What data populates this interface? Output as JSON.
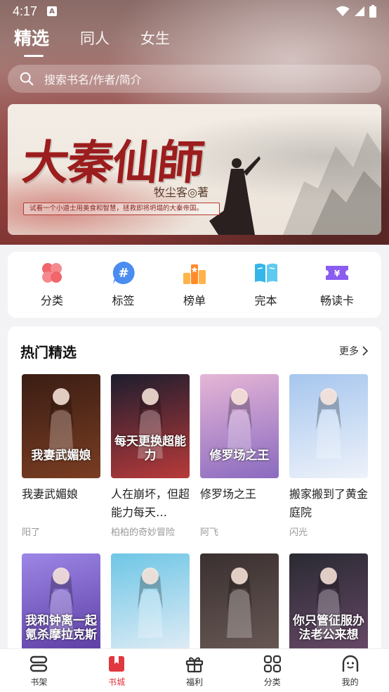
{
  "status_bar": {
    "time": "4:17",
    "indicator": "A"
  },
  "top_tabs": [
    {
      "label": "精选",
      "active": true
    },
    {
      "label": "同人",
      "active": false
    },
    {
      "label": "女生",
      "active": false
    }
  ],
  "search": {
    "placeholder": "搜索书名/作者/简介"
  },
  "banner": {
    "title": "大秦仙師",
    "author": "牧尘客◎著",
    "tagline": "试看一个小道士用美食和智慧，拯救即将坍塌的大秦帝国。"
  },
  "categories": [
    {
      "label": "分类",
      "icon": "clover-icon",
      "color": "#f0666b"
    },
    {
      "label": "标签",
      "icon": "hashtag-icon",
      "color": "#4a8cf0"
    },
    {
      "label": "榜单",
      "icon": "ranking-icon",
      "color": "#ff8a2a"
    },
    {
      "label": "完本",
      "icon": "open-book-icon",
      "color": "#35b6e8"
    },
    {
      "label": "畅读卡",
      "icon": "ticket-icon",
      "color": "#8a5cf0"
    }
  ],
  "hot_picks": {
    "title": "热门精选",
    "more_label": "更多",
    "books": [
      {
        "title": "我妻武媚娘",
        "author": "阳了",
        "cover_text": "我妻武媚娘",
        "cover_colors": [
          "#3a1d14",
          "#7a3d22"
        ]
      },
      {
        "title": "人在崩坏，但超能力每天…",
        "author": "柏柏的奇妙冒险",
        "cover_text": "每天更换超能力",
        "cover_colors": [
          "#1d1d2e",
          "#b83a3a"
        ]
      },
      {
        "title": "修罗场之王",
        "author": "阿飞",
        "cover_text": "修罗场之王",
        "cover_colors": [
          "#e6b6d6",
          "#8a6ac0"
        ]
      },
      {
        "title": "搬家搬到了黄金庭院",
        "author": "闪光",
        "cover_text": "",
        "cover_colors": [
          "#a6c6ee",
          "#eef2fa"
        ]
      },
      {
        "title": "",
        "author": "",
        "cover_text": "我和钟离一起氪杀摩拉克斯",
        "cover_colors": [
          "#9c86e6",
          "#5a3aa0"
        ]
      },
      {
        "title": "",
        "author": "",
        "cover_text": "",
        "cover_colors": [
          "#6ec6e6",
          "#e6eef6"
        ]
      },
      {
        "title": "",
        "author": "",
        "cover_text": "",
        "cover_colors": [
          "#3a3030",
          "#6a5a56"
        ]
      },
      {
        "title": "",
        "author": "",
        "cover_text": "你只管征服办法老公来想",
        "cover_colors": [
          "#2a2a32",
          "#6a4a6a"
        ]
      }
    ]
  },
  "bottom_nav": [
    {
      "label": "书架",
      "icon": "bookshelf-icon",
      "active": false
    },
    {
      "label": "书城",
      "icon": "bookstore-icon",
      "active": true
    },
    {
      "label": "福利",
      "icon": "gift-icon",
      "active": false
    },
    {
      "label": "分类",
      "icon": "grid-icon",
      "active": false
    },
    {
      "label": "我的",
      "icon": "profile-icon",
      "active": false
    }
  ],
  "colors": {
    "accent": "#e0383e",
    "banner_red": "#9c1d1d"
  }
}
